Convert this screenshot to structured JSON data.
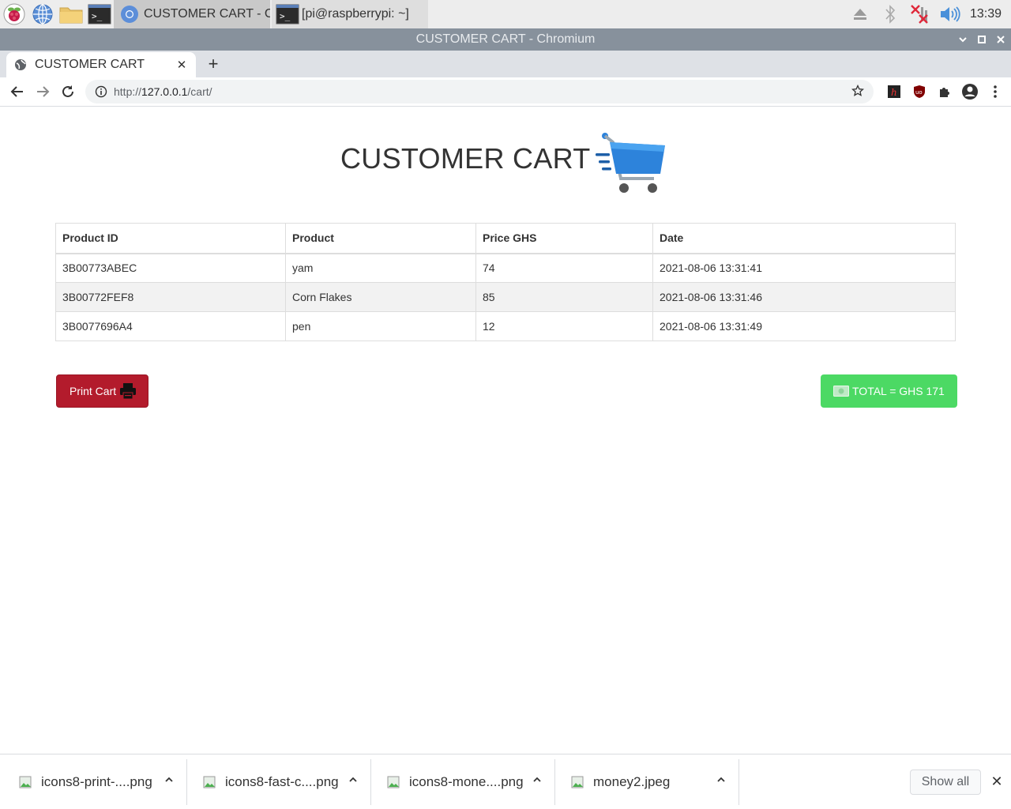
{
  "taskbar": {
    "tasks": [
      {
        "label": "CUSTOMER CART - C...",
        "icon": "chromium-icon"
      },
      {
        "label": "[pi@raspberrypi: ~]",
        "icon": "terminal-icon"
      }
    ],
    "clock": "13:39"
  },
  "window": {
    "title": "CUSTOMER CART - Chromium"
  },
  "browser": {
    "tab_title": "CUSTOMER CART",
    "url_scheme": "http://",
    "url_host": "127.0.0.1",
    "url_path": "/cart/"
  },
  "page": {
    "heading": "CUSTOMER CART",
    "table": {
      "headers": [
        "Product ID",
        "Product",
        "Price GHS",
        "Date"
      ],
      "rows": [
        [
          "3B00773ABEC",
          "yam",
          "74",
          "2021-08-06 13:31:41"
        ],
        [
          "3B00772FEF8",
          "Corn Flakes",
          "85",
          "2021-08-06 13:31:46"
        ],
        [
          "3B0077696A4",
          "pen",
          "12",
          "2021-08-06 13:31:49"
        ]
      ]
    },
    "print_label": "Print Cart",
    "total_label": "TOTAL = GHS 171",
    "colors": {
      "print": "#b31b2c",
      "total": "#4cd964",
      "cart": "#2d83db"
    }
  },
  "downloads": {
    "items": [
      "icons8-print-....png",
      "icons8-fast-c....png",
      "icons8-mone....png",
      "money2.jpeg"
    ],
    "show_all": "Show all"
  }
}
